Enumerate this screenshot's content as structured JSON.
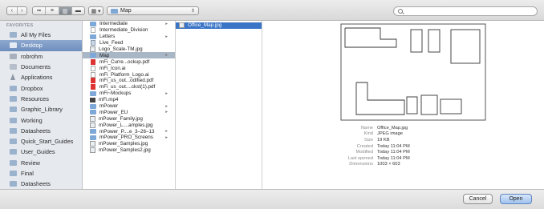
{
  "toolbar": {
    "nav_back": "‹",
    "nav_forward": "›",
    "view_modes": [
      "icon-view",
      "list-view",
      "column-view",
      "cover-flow-view"
    ],
    "active_view_mode": "column-view",
    "arrange_label": "▦ ▾",
    "location": "Map",
    "location_arrows": "⇕",
    "search_placeholder": "",
    "search_value": ""
  },
  "sidebar": {
    "heading": "FAVORITES",
    "items": [
      {
        "label": "All My Files",
        "icon": "all-files-icon"
      },
      {
        "label": "Desktop",
        "icon": "desktop-icon",
        "selected": true
      },
      {
        "label": "robrohm",
        "icon": "home-icon"
      },
      {
        "label": "Documents",
        "icon": "documents-icon"
      },
      {
        "label": "Applications",
        "icon": "applications-icon"
      },
      {
        "label": "Dropbox",
        "icon": "folder-icon"
      },
      {
        "label": "Resources",
        "icon": "folder-icon"
      },
      {
        "label": "Graphic_Library",
        "icon": "folder-icon"
      },
      {
        "label": "Working",
        "icon": "folder-icon"
      },
      {
        "label": "Datasheets",
        "icon": "folder-icon"
      },
      {
        "label": "Quick_Start_Guides",
        "icon": "folder-icon"
      },
      {
        "label": "User_Guides",
        "icon": "folder-icon"
      },
      {
        "label": "Review",
        "icon": "folder-icon"
      },
      {
        "label": "Final",
        "icon": "folder-icon"
      },
      {
        "label": "Datasheets",
        "icon": "folder-icon"
      }
    ]
  },
  "column1": {
    "items": [
      {
        "label": "Intermediate",
        "type": "folder",
        "has_children": true
      },
      {
        "label": "Intermediate_Division",
        "type": "file",
        "has_children": false
      },
      {
        "label": "Letters",
        "type": "folder",
        "has_children": true
      },
      {
        "label": "Live_Feed",
        "type": "doc",
        "has_children": false
      },
      {
        "label": "Logo_Scale-TM.jpg",
        "type": "img",
        "has_children": false
      },
      {
        "label": "Map",
        "type": "folder",
        "has_children": true,
        "selected": true
      },
      {
        "label": "mFi_Curre...ockup.pdf",
        "type": "pdf",
        "has_children": false
      },
      {
        "label": "mFi_Icon.ai",
        "type": "file",
        "has_children": false
      },
      {
        "label": "mFi_Platform_Logo.ai",
        "type": "file",
        "has_children": false
      },
      {
        "label": "mFi_us_out...odified.pdf",
        "type": "pdf",
        "has_children": false
      },
      {
        "label": "mFi_us_out....ckst(1).pdf",
        "type": "pdf",
        "has_children": false
      },
      {
        "label": "mFi~Mockups",
        "type": "folder",
        "has_children": true
      },
      {
        "label": "mFi.mp4",
        "type": "vid",
        "has_children": false
      },
      {
        "label": "mPower",
        "type": "folder",
        "has_children": true
      },
      {
        "label": "mPower_EU",
        "type": "folder",
        "has_children": true
      },
      {
        "label": "mPower_Family.jpg",
        "type": "img",
        "has_children": false
      },
      {
        "label": "mPower_L....amples.jpg",
        "type": "img",
        "has_children": false
      },
      {
        "label": "mPower_P....e_3–26–13",
        "type": "folder",
        "has_children": true
      },
      {
        "label": "mPower_PRO_Screens",
        "type": "folder",
        "has_children": true
      },
      {
        "label": "mPower_Samples.jpg",
        "type": "img",
        "has_children": false
      },
      {
        "label": "mPower_Samples2.jpg",
        "type": "img",
        "has_children": false
      }
    ]
  },
  "column2": {
    "items": [
      {
        "label": "Office_Map.jpg",
        "type": "img",
        "selected": true
      }
    ]
  },
  "preview": {
    "metadata": [
      {
        "key": "Name",
        "value": "Office_Map.jpg"
      },
      {
        "key": "Kind",
        "value": "JPEG image"
      },
      {
        "key": "Size",
        "value": "19 KB"
      },
      {
        "key": "Created",
        "value": "Today 11:04 PM"
      },
      {
        "key": "Modified",
        "value": "Today 11:04 PM"
      },
      {
        "key": "Last opened",
        "value": "Today 11:04 PM"
      },
      {
        "key": "Dimensions",
        "value": "1003 × 603"
      }
    ]
  },
  "buttons": {
    "cancel": "Cancel",
    "open": "Open"
  },
  "colors": {
    "selection_blue": "#3a74c6",
    "sidebar_selected": "#7b98c4",
    "folder_blue": "#7ea8d8"
  }
}
